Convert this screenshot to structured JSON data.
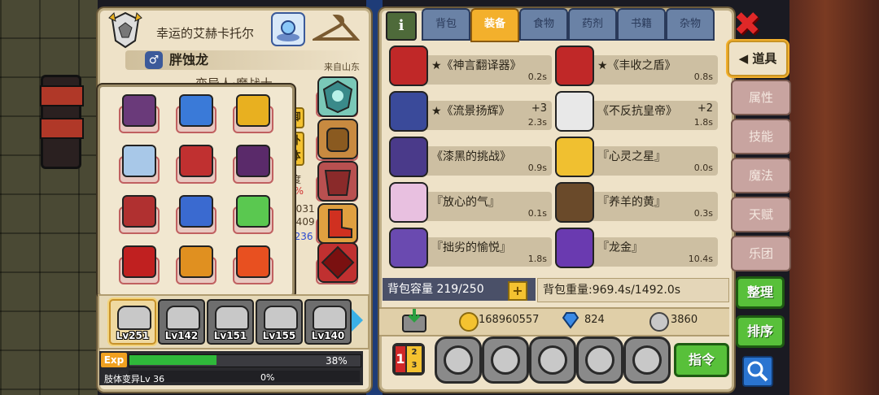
{
  "character": {
    "title_name": "幸运的艾赫卡托尔",
    "gender_symbol": "♂",
    "name": "胖蚀龙",
    "origin": "来自山东",
    "race_class": "变异人·魔战士",
    "stat_fragments": [
      "御",
      "外",
      "体",
      "度",
      "9%",
      "/8031",
      "/2409",
      "7236"
    ]
  },
  "equipment_grid": [
    {
      "name": "helmet-item"
    },
    {
      "name": "amulet-blue-gem"
    },
    {
      "name": "gold-mask"
    },
    {
      "name": "necklace-blue"
    },
    {
      "name": "red-armor"
    },
    {
      "name": "bat-wings"
    },
    {
      "name": "red-gauntlet"
    },
    {
      "name": "blue-cape"
    },
    {
      "name": "green-sword"
    },
    {
      "name": "red-blade"
    },
    {
      "name": "gold-dagger"
    },
    {
      "name": "fire-dagger"
    }
  ],
  "pets": [
    {
      "level": "Lv251",
      "active": true
    },
    {
      "level": "Lv142",
      "active": false
    },
    {
      "level": "Lv151",
      "active": false
    },
    {
      "level": "Lv155",
      "active": false
    },
    {
      "level": "Lv140",
      "active": false
    }
  ],
  "exp": {
    "label": "Exp",
    "percent": 38,
    "percent_text": "38%",
    "sub_label": "肢体变异Lv 36",
    "sub_percent_text": "0%"
  },
  "tabs": [
    {
      "label": "背包",
      "active": false
    },
    {
      "label": "装备",
      "active": true
    },
    {
      "label": "食物",
      "active": false
    },
    {
      "label": "药剂",
      "active": false
    },
    {
      "label": "书籍",
      "active": false
    },
    {
      "label": "杂物",
      "active": false
    }
  ],
  "items": [
    {
      "name": "★《神言翻译器》",
      "weight": "0.2s",
      "plus": ""
    },
    {
      "name": "★《丰收之盾》",
      "weight": "0.8s",
      "plus": ""
    },
    {
      "name": "★《流景扬辉》",
      "weight": "2.3s",
      "plus": "+3"
    },
    {
      "name": "《不反抗皇帝》",
      "weight": "1.8s",
      "plus": "+2"
    },
    {
      "name": "《漆黑的挑战》",
      "weight": "0.9s",
      "plus": ""
    },
    {
      "name": "『心灵之星』",
      "weight": "0.0s",
      "plus": ""
    },
    {
      "name": "『放心的气』",
      "weight": "0.1s",
      "plus": ""
    },
    {
      "name": "『养羊的黄』",
      "weight": "0.3s",
      "plus": ""
    },
    {
      "name": "『拙劣的愉悦』",
      "weight": "1.8s",
      "plus": ""
    },
    {
      "name": "『龙金』",
      "weight": "10.4s",
      "plus": ""
    }
  ],
  "capacity": "背包容量 219/250",
  "weight": "背包重量:969.4s/1492.0s",
  "currency": {
    "gold": "168960557",
    "diamond": "824",
    "silver": "3860"
  },
  "command_button": "指令",
  "side_menu": [
    {
      "label": "道具",
      "active": true
    },
    {
      "label": "属性",
      "active": false
    },
    {
      "label": "技能",
      "active": false
    },
    {
      "label": "魔法",
      "active": false
    },
    {
      "label": "天赋",
      "active": false
    },
    {
      "label": "乐团",
      "active": false
    }
  ],
  "organize_button": "整理",
  "sort_button": "排序",
  "colors": {
    "accent": "#f3b02c",
    "panel": "#eee2c8",
    "green": "#58c03a",
    "close": "#e02828"
  }
}
